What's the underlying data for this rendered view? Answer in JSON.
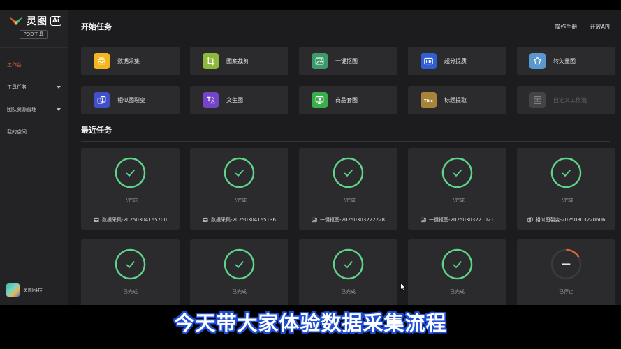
{
  "app": {
    "logo_text": "灵图",
    "logo_ai": "Ai",
    "badge": "POD工具"
  },
  "sidebar": {
    "items": [
      {
        "label": "工作台",
        "active": true
      },
      {
        "label": "工具任务",
        "has_caret": true
      },
      {
        "label": "团队资源管理",
        "has_caret": true
      },
      {
        "label": "我的空间"
      }
    ],
    "user_name": "灵图科技"
  },
  "header": {
    "title": "开始任务",
    "links": [
      "操作手册",
      "开放API"
    ]
  },
  "tools": [
    {
      "label": "数据采集",
      "icon": "data-collect-icon",
      "color": "#f5b51e"
    },
    {
      "label": "图案裁剪",
      "icon": "crop-icon",
      "color": "#8cb83c"
    },
    {
      "label": "一键抠图",
      "icon": "image-cutout-icon",
      "color": "#3c9a6b"
    },
    {
      "label": "超分提质",
      "icon": "hd-icon",
      "color": "#2f5fd0"
    },
    {
      "label": "转矢量图",
      "icon": "vector-icon",
      "color": "#5a98d0"
    },
    {
      "label": "相似图裂变",
      "icon": "similar-icon",
      "color": "#4150c8"
    },
    {
      "label": "文生图",
      "icon": "text-to-image-icon",
      "color": "#7445c8"
    },
    {
      "label": "商品套图",
      "icon": "product-set-icon",
      "color": "#3aae4a"
    },
    {
      "label": "标题提取",
      "icon": "title-icon",
      "color": "#a8843a"
    },
    {
      "label": "自定义工作流",
      "icon": "workflow-icon",
      "color": "#444447",
      "disabled": true
    }
  ],
  "recent": {
    "title": "最近任务",
    "tasks": [
      {
        "status": "已完成",
        "name": "数据采集-20250304165700",
        "icon": "data-collect-icon",
        "state": "done"
      },
      {
        "status": "已完成",
        "name": "数据采集-20250304165136",
        "icon": "data-collect-icon",
        "state": "done"
      },
      {
        "status": "已完成",
        "name": "一键抠图-20250303222228",
        "icon": "image-cutout-icon",
        "state": "done"
      },
      {
        "status": "已完成",
        "name": "一键抠图-20250303221021",
        "icon": "image-cutout-icon",
        "state": "done"
      },
      {
        "status": "已完成",
        "name": "相似图裂变-20250303220606",
        "icon": "similar-icon",
        "state": "done"
      },
      {
        "status": "已完成",
        "name": "",
        "icon": "",
        "state": "done"
      },
      {
        "status": "已完成",
        "name": "",
        "icon": "",
        "state": "done"
      },
      {
        "status": "已完成",
        "name": "",
        "icon": "",
        "state": "done"
      },
      {
        "status": "已完成",
        "name": "",
        "icon": "",
        "state": "done"
      },
      {
        "status": "已停止",
        "name": "",
        "icon": "",
        "state": "stopped"
      }
    ]
  },
  "colors": {
    "accent": "#e0643c",
    "done": "#5fd38a",
    "stopped": "#e0643c"
  },
  "subtitle": "今天带大家体验数据采集流程"
}
